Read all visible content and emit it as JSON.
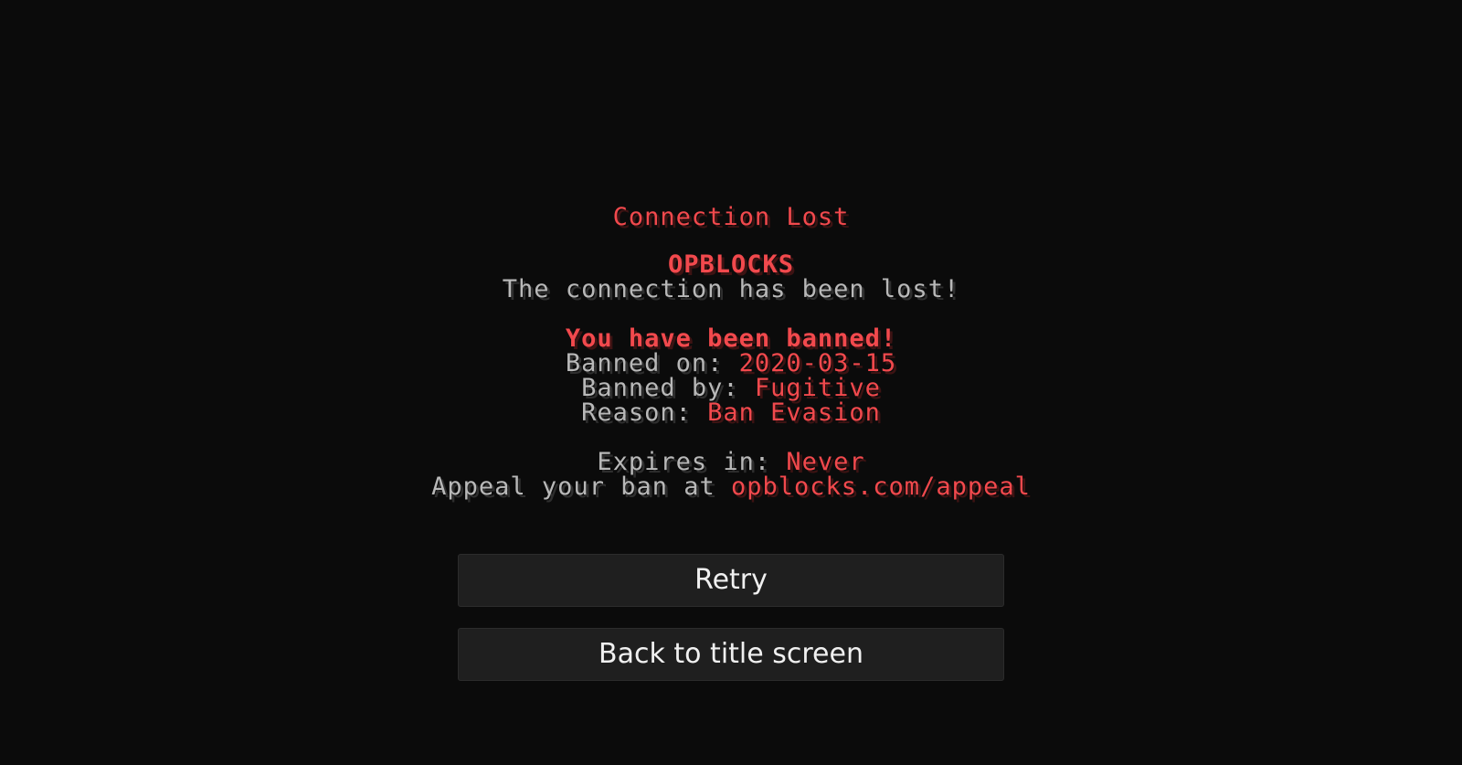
{
  "screen": {
    "title": "Connection Lost",
    "server_name": "OPBLOCKS",
    "lost_message": "The connection has been lost!",
    "ban_heading": "You have been banned!",
    "banned_on_label": "Banned on: ",
    "banned_on_value": "2020-03-15",
    "banned_by_label": "Banned by: ",
    "banned_by_value": "Fugitive",
    "reason_label": "Reason: ",
    "reason_value": "Ban Evasion",
    "expires_label": "Expires in: ",
    "expires_value": "Never",
    "appeal_label": "Appeal your ban at ",
    "appeal_value": "opblocks.com/appeal"
  },
  "buttons": {
    "retry_label": "Retry",
    "back_label": "Back to title screen"
  },
  "colors": {
    "background": "#0b0b0b",
    "accent_red": "#f2494d",
    "text_gray": "#b8b8b8",
    "button_bg": "#1f1f1f"
  }
}
